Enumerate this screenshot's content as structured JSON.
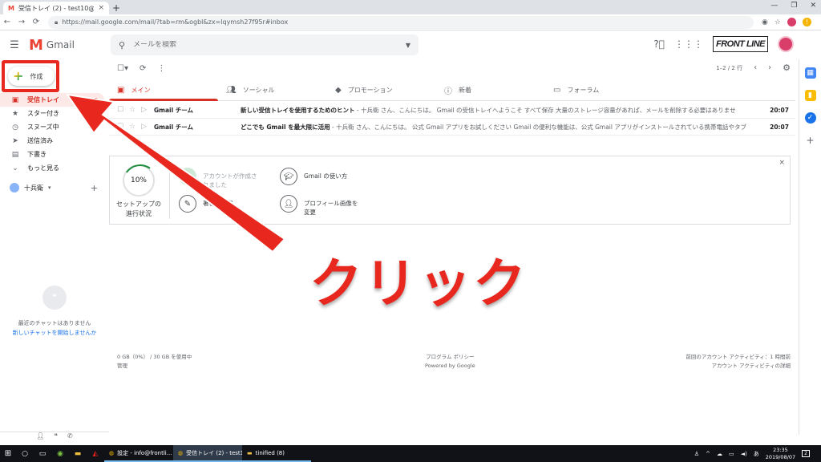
{
  "browser": {
    "tab_title": "受信トレイ (2) - test10@frontline",
    "tab_close": "×",
    "new_tab": "+",
    "url": "https://mail.google.com/mail/?tab=rm&ogbl&zx=lqymsh27f95r#inbox",
    "window_controls": [
      "—",
      "❐",
      "✕"
    ]
  },
  "header": {
    "app_name": "Gmail",
    "search_placeholder": "メールを検索",
    "brand": "FRONT LINE"
  },
  "sidebar": {
    "compose_label": "作成",
    "items": [
      {
        "label": "受信トレイ",
        "count": "2",
        "icon": "inbox-icon"
      },
      {
        "label": "スター付き",
        "icon": "star-icon"
      },
      {
        "label": "スヌーズ中",
        "icon": "clock-icon"
      },
      {
        "label": "送信済み",
        "icon": "send-icon"
      },
      {
        "label": "下書き",
        "icon": "draft-icon"
      },
      {
        "label": "もっと見る",
        "icon": "chevron-down-icon"
      }
    ],
    "account_name": "十兵衛",
    "chat_empty": "最近のチャットはありません",
    "chat_start": "新しいチャットを開始しませんか"
  },
  "toolbar": {
    "pager": "1–2 / 2 行"
  },
  "tabs": [
    {
      "label": "メイン",
      "icon": "inbox-icon"
    },
    {
      "label": "ソーシャル",
      "icon": "people-icon"
    },
    {
      "label": "プロモーション",
      "icon": "tag-icon"
    },
    {
      "label": "新着",
      "icon": "info-icon"
    },
    {
      "label": "フォーラム",
      "icon": "forum-icon"
    }
  ],
  "emails": [
    {
      "sender": "Gmail チーム",
      "subject": "新しい受信トレイを使用するためのヒント",
      "snippet": " - 十兵衛 さん、こんにちは。 Gmail の受信トレイへようこそ すべて保存 大量のストレージ容量があれば、メールを削除する必要はありませ",
      "time": "20:07"
    },
    {
      "sender": "Gmail チーム",
      "subject": "どこでも Gmail を最大限に活用",
      "snippet": " - 十兵衛 さん、こんにちは。 公式 Gmail アプリをお試しください Gmail の便利な機能は、公式 Gmail アプリがインストールされている携帯電話やタブ",
      "time": "20:07"
    }
  ],
  "setup": {
    "progress_value": "10%",
    "progress_label_1": "セットアップの",
    "progress_label_2": "進行状況",
    "tasks": [
      {
        "label": "アカウントが作成されました",
        "done": true
      },
      {
        "label": "Gmail の使い方",
        "done": false
      },
      {
        "label": "署名を設定",
        "done": false
      },
      {
        "label": "プロフィール画像を変更",
        "done": false
      }
    ],
    "close": "×"
  },
  "footer": {
    "storage": "0 GB（0%） / 30 GB を使用中",
    "manage": "管理",
    "policy": "プログラム ポリシー",
    "powered": "Powered by Google",
    "last_activity": "前回のアカウント アクティビティ：1 時間前",
    "details": "アカウント アクティビティの詳細"
  },
  "overlay": {
    "label": "クリック",
    "color": "#e8281e"
  },
  "taskbar": {
    "items": [
      {
        "label": "設定 - info@frontli..."
      },
      {
        "label": "受信トレイ (2) - test1..."
      },
      {
        "label": "tinified (8)"
      }
    ],
    "time": "23:35",
    "date": "2019/08/07",
    "notify_count": "2"
  }
}
